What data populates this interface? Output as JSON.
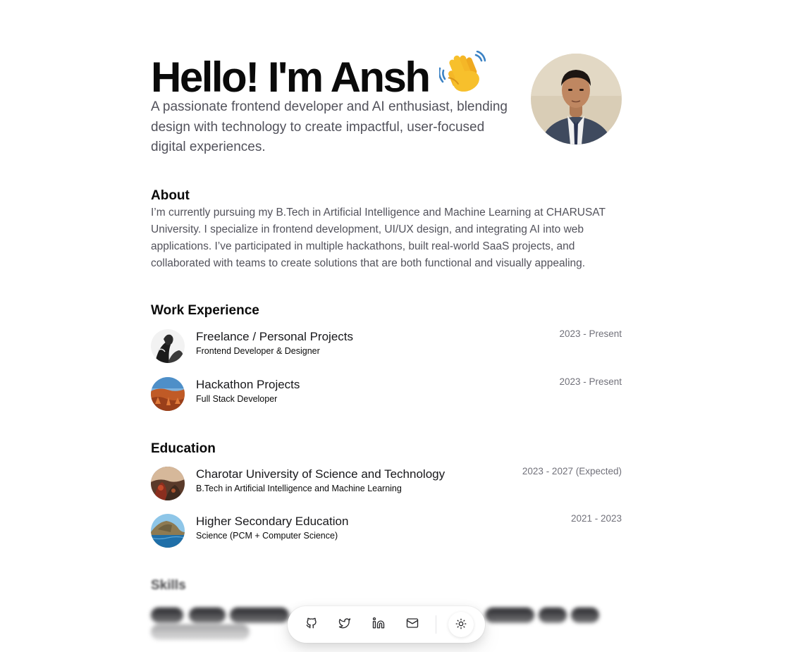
{
  "hero": {
    "title": "Hello! I'm Ansh",
    "wave_emoji": "waving-hand",
    "subtitle": "A passionate frontend developer and AI enthusiast, blending design with technology to create impactful, user-focused digital experiences."
  },
  "about": {
    "heading": "About",
    "text": "I’m currently pursuing my B.Tech in Artificial Intelligence and Machine Learning at CHARUSAT University. I specialize in frontend development, UI/UX design, and integrating AI into web applications. I’ve participated in multiple hackathons, built real-world SaaS projects, and collaborated with teams to create solutions that are both functional and visually appealing."
  },
  "work": {
    "heading": "Work Experience",
    "items": [
      {
        "name": "Freelance / Personal Projects",
        "role": "Frontend Developer & Designer",
        "date": "2023 - Present"
      },
      {
        "name": "Hackathon Projects",
        "role": "Full Stack Developer",
        "date": "2023 - Present"
      }
    ]
  },
  "education": {
    "heading": "Education",
    "items": [
      {
        "name": "Charotar University of Science and Technology",
        "role": "B.Tech in Artificial Intelligence and Machine Learning",
        "date": "2023 - 2027 (Expected)"
      },
      {
        "name": "Higher Secondary Education",
        "role": "Science (PCM + Computer Science)",
        "date": "2021 - 2023"
      }
    ]
  },
  "skills": {
    "heading": "Skills"
  },
  "dock": {
    "icons": [
      "github-icon",
      "twitter-icon",
      "linkedin-icon",
      "mail-icon",
      "sun-icon"
    ]
  },
  "colors": {
    "text": "#0a0a0a",
    "muted": "#52525b",
    "date": "#71717a",
    "background": "#ffffff"
  }
}
